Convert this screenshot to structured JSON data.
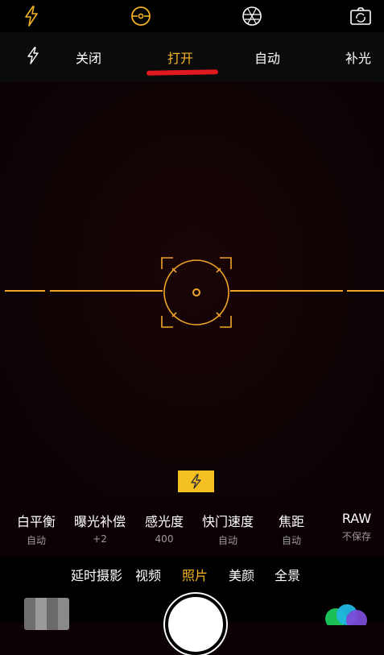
{
  "colors": {
    "accent": "#f5b323",
    "background": "#0d0203",
    "annotation": "#e0181f"
  },
  "topbar": {
    "icons": [
      "flash-icon",
      "level-icon",
      "filter-icon",
      "switch-camera-icon"
    ]
  },
  "flash_menu": {
    "icon": "flash-icon",
    "options": [
      {
        "label": "关闭",
        "active": false
      },
      {
        "label": "打开",
        "active": true
      },
      {
        "label": "自动",
        "active": false
      },
      {
        "label": "补光",
        "active": false
      }
    ]
  },
  "controls": [
    {
      "label": "白平衡",
      "value": "自动"
    },
    {
      "label": "曝光补偿",
      "value": "+2"
    },
    {
      "label": "感光度",
      "value": "400"
    },
    {
      "label": "快门速度",
      "value": "自动"
    },
    {
      "label": "焦距",
      "value": "自动"
    },
    {
      "label": "RAW",
      "value": "不保存"
    }
  ],
  "modes": [
    {
      "label": "延时摄影",
      "active": false
    },
    {
      "label": "视频",
      "active": false
    },
    {
      "label": "照片",
      "active": true
    },
    {
      "label": "美颜",
      "active": false
    },
    {
      "label": "全景",
      "active": false
    }
  ]
}
